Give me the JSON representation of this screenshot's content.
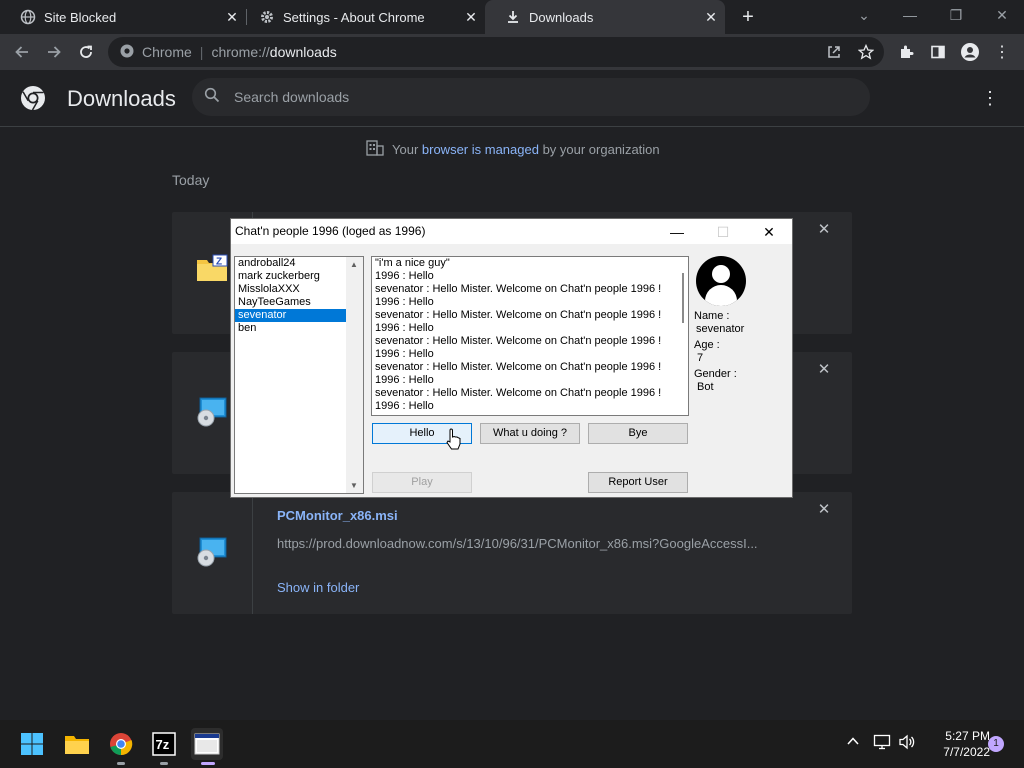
{
  "tabs": [
    {
      "title": "Site Blocked",
      "icon": "globe-icon"
    },
    {
      "title": "Settings - About Chrome",
      "icon": "gear-icon"
    },
    {
      "title": "Downloads",
      "icon": "download-icon"
    }
  ],
  "omnibox": {
    "site": "Chrome",
    "scheme": "chrome://",
    "host": "downloads"
  },
  "downloads": {
    "title": "Downloads",
    "search_placeholder": "Search downloads",
    "managed_prefix": "Your ",
    "managed_link": "browser is managed",
    "managed_suffix": " by your organization",
    "section": "Today",
    "item3": {
      "name": "PCMonitor_x86.msi",
      "url": "https://prod.downloadnow.com/s/13/10/96/31/PCMonitor_x86.msi?GoogleAccessI...",
      "action": "Show in folder"
    }
  },
  "chat": {
    "title": "Chat'n people 1996 (loged as 1996)",
    "users": [
      "androball24",
      "mark zuckerberg",
      "MisslolaXXX",
      "NayTeeGames",
      "sevenator",
      "ben"
    ],
    "selected_user": "sevenator",
    "messages": [
      "\"i'm a nice guy\"",
      "1996 : Hello",
      "sevenator : Hello Mister. Welcome on Chat'n people 1996 !",
      "1996 : Hello",
      "sevenator : Hello Mister. Welcome on Chat'n people 1996 !",
      "1996 : Hello",
      "sevenator : Hello Mister. Welcome on Chat'n people 1996 !",
      "1996 : Hello",
      "sevenator : Hello Mister. Welcome on Chat'n people 1996 !",
      "1996 : Hello",
      "sevenator : Hello Mister. Welcome on Chat'n people 1996 !",
      "1996 : Hello"
    ],
    "buttons": {
      "hello": "Hello",
      "doing": "What u doing ?",
      "bye": "Bye",
      "play": "Play",
      "report": "Report User"
    },
    "profile": {
      "name_label": "Name :",
      "name_value": "sevenator",
      "age_label": "Age :",
      "age_value": "7",
      "gender_label": "Gender :",
      "gender_value": "Bot"
    }
  },
  "taskbar": {
    "time": "5:27 PM",
    "date": "7/7/2022",
    "notifications": "1",
    "sevenzip_label": "7z"
  },
  "colors": {
    "accent": "#8ab4f8",
    "selection": "#0078d7"
  }
}
